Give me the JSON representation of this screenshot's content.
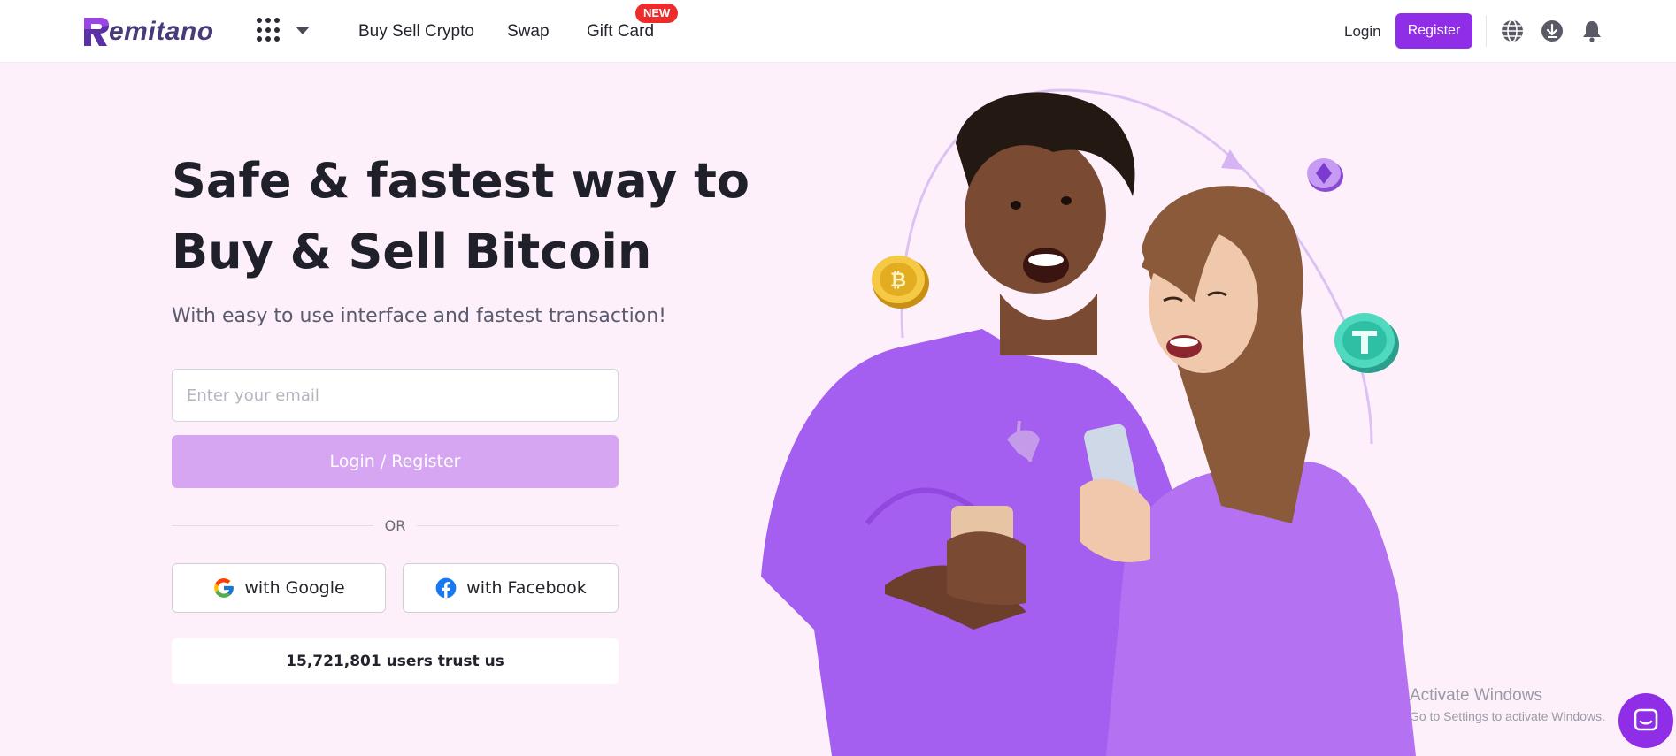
{
  "header": {
    "logo_text": "emitano",
    "nav": {
      "buy_sell": "Buy Sell Crypto",
      "swap": "Swap",
      "gift_card": "Gift Card",
      "gift_badge": "NEW"
    },
    "login": "Login",
    "register": "Register",
    "icons": [
      "apps-grid-icon",
      "chevron-down-icon",
      "globe-icon",
      "download-icon",
      "bell-icon"
    ]
  },
  "hero": {
    "title_line1": "Safe & fastest way to",
    "title_line2": "Buy & Sell Bitcoin",
    "subtitle": "With easy to use interface and fastest transaction!",
    "email_placeholder": "Enter your email",
    "email_value": "",
    "submit_label": "Login / Register",
    "or_text": "OR",
    "google_label": "with Google",
    "facebook_label": "with Facebook",
    "trust_text": "15,721,801 users trust us"
  },
  "overlay": {
    "watermark_title": "Activate Windows",
    "watermark_sub": "Go to Settings to activate Windows."
  },
  "colors": {
    "brand": "#8f2ee6",
    "brand_light": "#d6a6f2",
    "page_bg": "#fdf0fb",
    "badge": "#ee2b2b"
  }
}
